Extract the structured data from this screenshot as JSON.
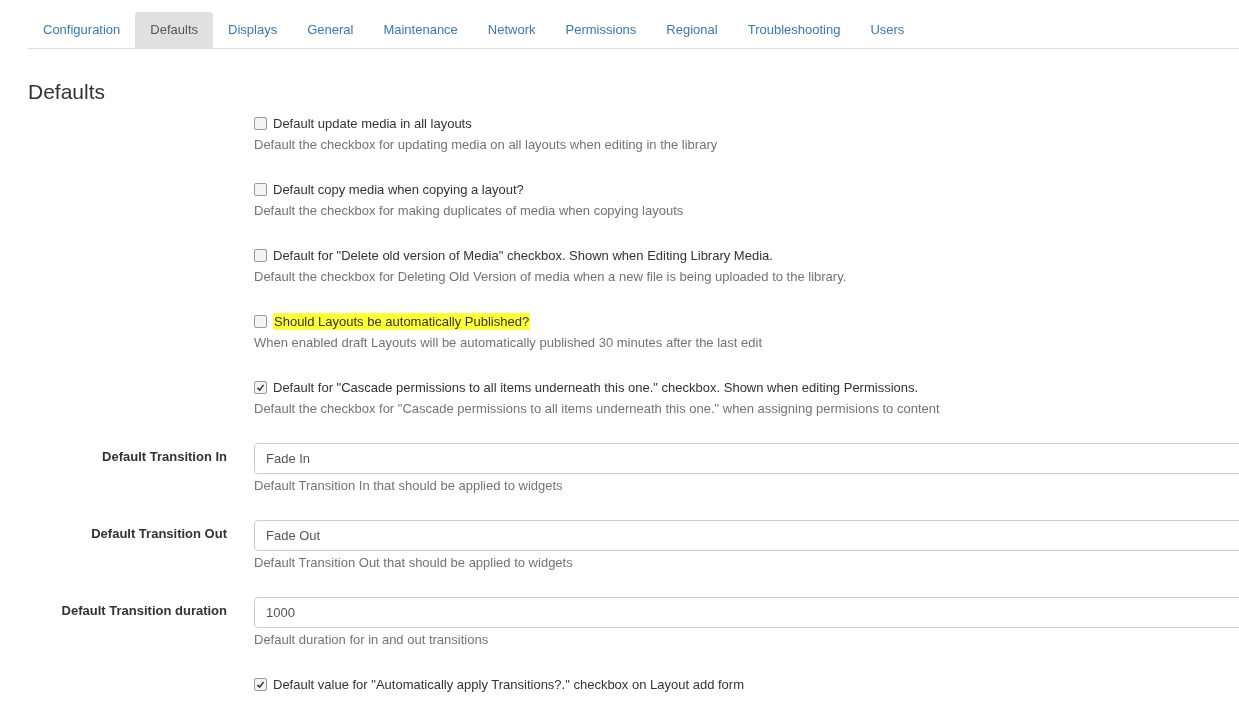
{
  "tabs": [
    {
      "label": "Configuration",
      "selected": false
    },
    {
      "label": "Defaults",
      "selected": true
    },
    {
      "label": "Displays",
      "selected": false
    },
    {
      "label": "General",
      "selected": false
    },
    {
      "label": "Maintenance",
      "selected": false
    },
    {
      "label": "Network",
      "selected": false
    },
    {
      "label": "Permissions",
      "selected": false
    },
    {
      "label": "Regional",
      "selected": false
    },
    {
      "label": "Troubleshooting",
      "selected": false
    },
    {
      "label": "Users",
      "selected": false
    }
  ],
  "heading": "Defaults",
  "settings": [
    {
      "kind": "checkbox",
      "label": "Default update media in all layouts",
      "checked": false,
      "highlighted": false,
      "help": "Default the checkbox for updating media on all layouts when editing in the library"
    },
    {
      "kind": "checkbox",
      "label": "Default copy media when copying a layout?",
      "checked": false,
      "highlighted": false,
      "help": "Default the checkbox for making duplicates of media when copying layouts"
    },
    {
      "kind": "checkbox",
      "label": "Default for \"Delete old version of Media\" checkbox. Shown when Editing Library Media.",
      "checked": false,
      "highlighted": false,
      "help": "Default the checkbox for Deleting Old Version of media when a new file is being uploaded to the library."
    },
    {
      "kind": "checkbox",
      "label": "Should Layouts be automatically Published?",
      "checked": false,
      "highlighted": true,
      "help": "When enabled draft Layouts will be automatically published 30 minutes after the last edit"
    },
    {
      "kind": "checkbox",
      "label": "Default for \"Cascade permissions to all items underneath this one.\" checkbox. Shown when editing Permissions.",
      "checked": true,
      "highlighted": false,
      "help": "Default the checkbox for \"Cascade permissions to all items underneath this one.\" when assigning permisions to content"
    },
    {
      "kind": "text",
      "label": "Default Transition In",
      "value": "Fade In",
      "help": "Default Transition In that should be applied to widgets"
    },
    {
      "kind": "text",
      "label": "Default Transition Out",
      "value": "Fade Out",
      "help": "Default Transition Out that should be applied to widgets"
    },
    {
      "kind": "text",
      "label": "Default Transition duration",
      "value": "1000",
      "help": "Default duration for in and out transitions"
    },
    {
      "kind": "checkbox",
      "label": "Default value for \"Automatically apply Transitions?.\" checkbox on Layout add form",
      "checked": true,
      "highlighted": false
    }
  ]
}
